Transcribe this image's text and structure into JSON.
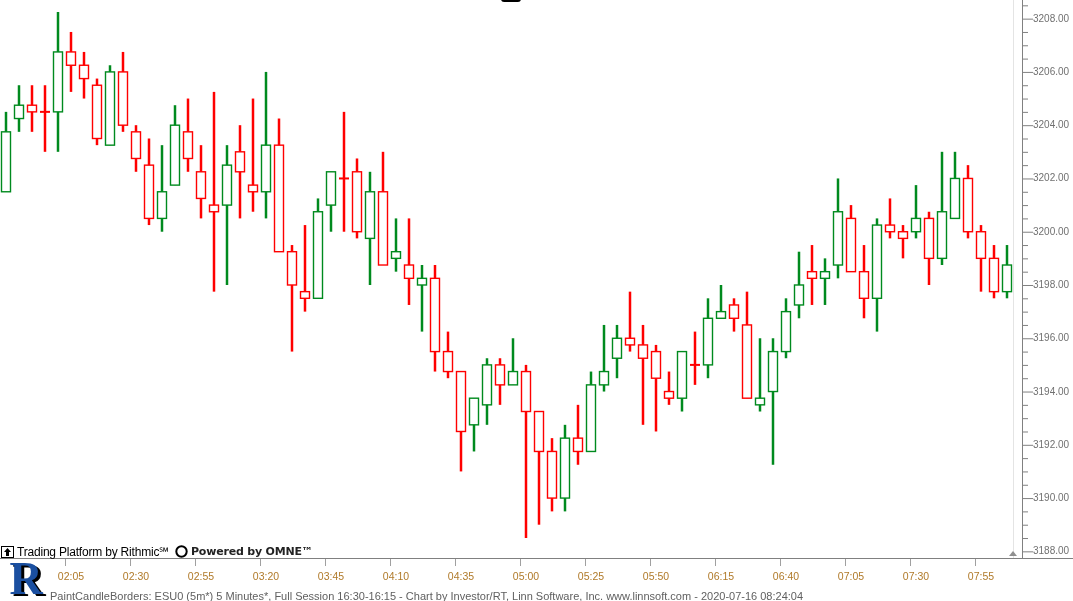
{
  "chart": {
    "chart_data": {
      "type": "candlestick",
      "categories": [
        null,
        null,
        null,
        null,
        null,
        "02:05",
        null,
        null,
        null,
        null,
        "02:30",
        null,
        null,
        null,
        null,
        "02:55",
        null,
        null,
        null,
        null,
        "03:20",
        null,
        null,
        null,
        null,
        "03:45",
        null,
        null,
        null,
        null,
        "04:10",
        null,
        null,
        null,
        null,
        "04:35",
        null,
        null,
        null,
        null,
        "05:00",
        null,
        null,
        null,
        null,
        "05:25",
        null,
        null,
        null,
        null,
        "05:50",
        null,
        null,
        null,
        null,
        "06:15",
        null,
        null,
        null,
        null,
        "06:40",
        null,
        null,
        null,
        null,
        "07:05",
        null,
        null,
        null,
        null,
        "07:30",
        null,
        null,
        null,
        null,
        "07:55",
        null,
        null
      ],
      "ylim": [
        3187.75,
        3208.7
      ],
      "ohlc": [
        [
          3201.5,
          3204.5,
          3201.5,
          3203.75
        ],
        [
          3204.25,
          3205.5,
          3203.75,
          3204.75
        ],
        [
          3204.75,
          3205.5,
          3203.75,
          3204.5
        ],
        [
          3204.5,
          3205.5,
          3203,
          3204.5
        ],
        [
          3204.5,
          3208.25,
          3203,
          3206.75
        ],
        [
          3206.75,
          3207.5,
          3205.25,
          3206.25
        ],
        [
          3206.25,
          3206.75,
          3205,
          3205.75
        ],
        [
          3205.5,
          3205.75,
          3203.25,
          3203.5
        ],
        [
          3203.25,
          3206.25,
          3203.25,
          3206
        ],
        [
          3206,
          3206.75,
          3203.75,
          3204
        ],
        [
          3203.75,
          3204,
          3202.25,
          3202.75
        ],
        [
          3202.5,
          3203.5,
          3200.25,
          3200.5
        ],
        [
          3200.5,
          3203.25,
          3200,
          3201.5
        ],
        [
          3201.75,
          3204.75,
          3201.75,
          3204
        ],
        [
          3203.75,
          3205,
          3202.25,
          3202.75
        ],
        [
          3202.25,
          3203.25,
          3200.5,
          3201.25
        ],
        [
          3201,
          3205.25,
          3197.75,
          3200.75
        ],
        [
          3201,
          3203.25,
          3198,
          3202.5
        ],
        [
          3203,
          3204,
          3200.5,
          3202.25
        ],
        [
          3201.75,
          3205,
          3200.75,
          3201.5
        ],
        [
          3201.5,
          3206,
          3200.5,
          3203.25
        ],
        [
          3203.25,
          3204.25,
          3199.25,
          3199.25
        ],
        [
          3199.25,
          3199.5,
          3195.5,
          3198
        ],
        [
          3197.75,
          3200.25,
          3197,
          3197.5
        ],
        [
          3197.5,
          3201.25,
          3197.5,
          3200.75
        ],
        [
          3201,
          3202.25,
          3200,
          3202.25
        ],
        [
          3202,
          3204.5,
          3200,
          3202
        ],
        [
          3202.25,
          3202.75,
          3199.75,
          3200
        ],
        [
          3199.75,
          3202.25,
          3198,
          3201.5
        ],
        [
          3201.5,
          3203,
          3198.75,
          3198.75
        ],
        [
          3199,
          3200.5,
          3198.5,
          3199.25
        ],
        [
          3198.75,
          3200.5,
          3197.25,
          3198.25
        ],
        [
          3198,
          3198.75,
          3196.25,
          3198.25
        ],
        [
          3198.25,
          3198.75,
          3194.75,
          3195.5
        ],
        [
          3195.5,
          3196.25,
          3194.5,
          3194.75
        ],
        [
          3194.75,
          3194.75,
          3191,
          3192.5
        ],
        [
          3192.75,
          3193.75,
          3191.75,
          3193.75
        ],
        [
          3193.5,
          3195.25,
          3192.75,
          3195
        ],
        [
          3195,
          3195.25,
          3193.5,
          3194.25
        ],
        [
          3194.25,
          3196,
          3194.25,
          3194.75
        ],
        [
          3194.75,
          3195,
          3188.5,
          3193.25
        ],
        [
          3193.25,
          3193.25,
          3189,
          3191.75
        ],
        [
          3191.75,
          3192.25,
          3189.5,
          3190
        ],
        [
          3190,
          3192.75,
          3189.5,
          3192.25
        ],
        [
          3192.25,
          3193.5,
          3191.25,
          3191.75
        ],
        [
          3191.75,
          3194.75,
          3191.75,
          3194.25
        ],
        [
          3194.25,
          3196.5,
          3194,
          3194.75
        ],
        [
          3195.25,
          3196.5,
          3194.5,
          3196
        ],
        [
          3196,
          3197.75,
          3195.5,
          3195.75
        ],
        [
          3195.75,
          3196.5,
          3192.75,
          3195.25
        ],
        [
          3195.5,
          3195.75,
          3192.5,
          3194.5
        ],
        [
          3194,
          3194.75,
          3193.5,
          3193.75
        ],
        [
          3193.75,
          3195.5,
          3193.25,
          3195.5
        ],
        [
          3195,
          3196.25,
          3194.25,
          3195
        ],
        [
          3195,
          3197.5,
          3194.5,
          3196.75
        ],
        [
          3196.75,
          3198,
          3196.75,
          3197
        ],
        [
          3197.25,
          3197.5,
          3196.25,
          3196.75
        ],
        [
          3196.5,
          3197.75,
          3193.75,
          3193.75
        ],
        [
          3193.5,
          3196,
          3193.25,
          3193.75
        ],
        [
          3194,
          3196,
          3191.25,
          3195.5
        ],
        [
          3195.5,
          3197.5,
          3195.25,
          3197
        ],
        [
          3197.25,
          3199.25,
          3196.75,
          3198
        ],
        [
          3198.5,
          3199.5,
          3197.25,
          3198.25
        ],
        [
          3198.25,
          3199,
          3197.25,
          3198.5
        ],
        [
          3198.75,
          3202,
          3198.25,
          3200.75
        ],
        [
          3200.5,
          3201,
          3198.5,
          3198.5
        ],
        [
          3198.5,
          3199.5,
          3196.75,
          3197.5
        ],
        [
          3197.5,
          3200.5,
          3196.25,
          3200.25
        ],
        [
          3200.25,
          3201.25,
          3199.75,
          3200
        ],
        [
          3200,
          3200.25,
          3199,
          3199.75
        ],
        [
          3200,
          3201.75,
          3199.75,
          3200.5
        ],
        [
          3200.5,
          3200.75,
          3198,
          3199
        ],
        [
          3199,
          3203,
          3198.75,
          3200.75
        ],
        [
          3200.5,
          3203,
          3200.5,
          3202
        ],
        [
          3202,
          3202.5,
          3199.75,
          3200
        ],
        [
          3200,
          3200.25,
          3197.75,
          3199
        ],
        [
          3199,
          3199.5,
          3197.5,
          3197.75
        ],
        [
          3197.75,
          3199.5,
          3197.5,
          3198.75
        ]
      ],
      "yticks": [
        {
          "value": 3208,
          "label": "3208.00"
        },
        {
          "value": 3206,
          "label": "3206.00"
        },
        {
          "value": 3204,
          "label": "3204.00"
        },
        {
          "value": 3202,
          "label": "3202.00"
        },
        {
          "value": 3200,
          "label": "3200.00"
        },
        {
          "value": 3198,
          "label": "3198.00"
        },
        {
          "value": 3196,
          "label": "3196.00"
        },
        {
          "value": 3194,
          "label": "3194.00"
        },
        {
          "value": 3192,
          "label": "3192.00"
        },
        {
          "value": 3190,
          "label": "3190.00"
        },
        {
          "value": 3188,
          "label": "3188.00"
        }
      ]
    }
  },
  "branding": {
    "platform": "Trading Platform by Rithmic℠",
    "powered": "Powered by OMNE™",
    "logo_letter": "R"
  },
  "status_bar": "PaintCandleBorders: ESU0 (5m*) 5 Minutes*, Full Session 16:30-16:15 - Chart by Investor/RT, Linn Software, Inc. www.linnsoft.com - 2020-07-16 08:24:04"
}
